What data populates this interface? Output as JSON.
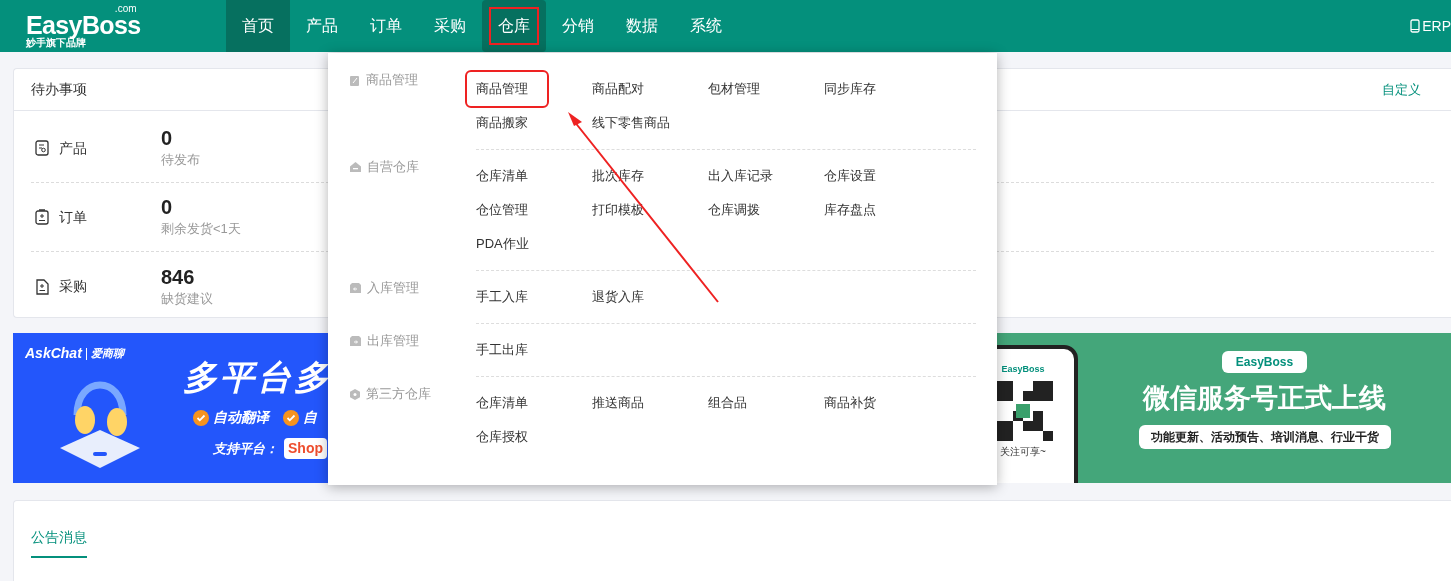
{
  "header": {
    "logo": "EasyBoss",
    "logo_suffix": ".com",
    "tagline": "妙手旗下品牌",
    "nav": [
      {
        "label": "首页",
        "selected": true,
        "annotated": false
      },
      {
        "label": "产品",
        "selected": false,
        "annotated": false
      },
      {
        "label": "订单",
        "selected": false,
        "annotated": false
      },
      {
        "label": "采购",
        "selected": false,
        "annotated": false
      },
      {
        "label": "仓库",
        "selected": true,
        "annotated": true
      },
      {
        "label": "分销",
        "selected": false,
        "annotated": false
      },
      {
        "label": "数据",
        "selected": false,
        "annotated": false
      },
      {
        "label": "系统",
        "selected": false,
        "annotated": false
      }
    ],
    "right_link": "ERP"
  },
  "todo_card": {
    "title": "待办事项",
    "action": "自定义",
    "rows": [
      {
        "kind": "product",
        "label": "产品",
        "value": "0",
        "caption": "待发布"
      },
      {
        "kind": "order",
        "label": "订单",
        "value": "0",
        "caption": "剩余发货<1天"
      },
      {
        "kind": "purchase",
        "label": "采购",
        "value": "846",
        "caption": "缺货建议"
      }
    ]
  },
  "banners": {
    "left": {
      "brand": "AskChat",
      "brand_cn": "爱商聊",
      "headline": "多平台多",
      "features": [
        "自动翻译",
        "自"
      ],
      "platform_label": "支持平台：",
      "platform": "Shop"
    },
    "right": {
      "phone_brand": "EasyBoss",
      "phone_caption": "关注可享~",
      "badge": "EasyBoss",
      "headline": "微信服务号正式上线",
      "subline": "功能更新、活动预告、培训消息、行业干货"
    }
  },
  "dropdown": {
    "sections": [
      {
        "kind": "goods",
        "title": "商品管理",
        "links": [
          {
            "label": "商品管理",
            "annotated": true
          },
          {
            "label": "商品配对",
            "annotated": false
          },
          {
            "label": "包材管理",
            "annotated": false
          },
          {
            "label": "同步库存",
            "annotated": false
          },
          {
            "label": "商品搬家",
            "annotated": false
          },
          {
            "label": "线下零售商品",
            "annotated": false
          }
        ]
      },
      {
        "kind": "home",
        "title": "自营仓库",
        "links": [
          {
            "label": "仓库清单",
            "annotated": false
          },
          {
            "label": "批次库存",
            "annotated": false
          },
          {
            "label": "出入库记录",
            "annotated": false
          },
          {
            "label": "仓库设置",
            "annotated": false
          },
          {
            "label": "仓位管理",
            "annotated": false
          },
          {
            "label": "打印模板",
            "annotated": false
          },
          {
            "label": "仓库调拨",
            "annotated": false
          },
          {
            "label": "库存盘点",
            "annotated": false
          },
          {
            "label": "PDA作业",
            "annotated": false
          }
        ]
      },
      {
        "kind": "inbound",
        "title": "入库管理",
        "links": [
          {
            "label": "手工入库",
            "annotated": false
          },
          {
            "label": "退货入库",
            "annotated": false
          }
        ]
      },
      {
        "kind": "outbound",
        "title": "出库管理",
        "links": [
          {
            "label": "手工出库",
            "annotated": false
          }
        ]
      },
      {
        "kind": "thirdparty",
        "title": "第三方仓库",
        "links": [
          {
            "label": "仓库清单",
            "annotated": false
          },
          {
            "label": "推送商品",
            "annotated": false
          },
          {
            "label": "组合品",
            "annotated": false
          },
          {
            "label": "商品补货",
            "annotated": false
          },
          {
            "label": "仓库授权",
            "annotated": false
          }
        ]
      }
    ]
  },
  "notice_card": {
    "tabs": [
      {
        "label": "公告消息",
        "selected": true
      }
    ]
  }
}
